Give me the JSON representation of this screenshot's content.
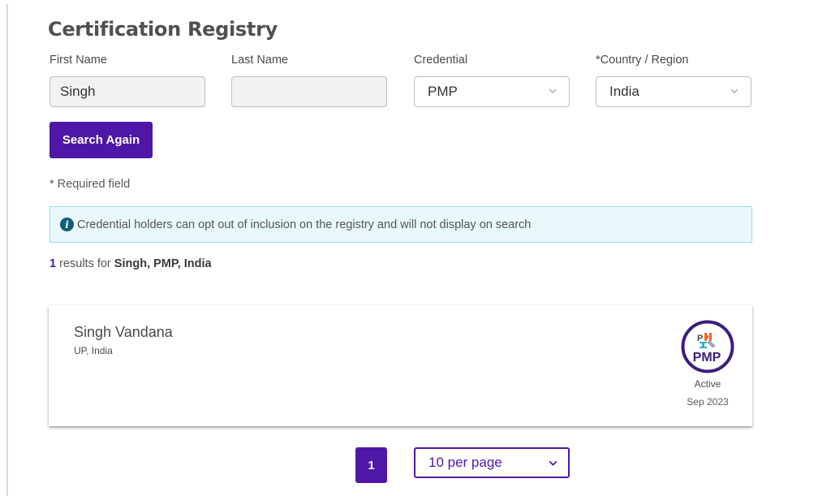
{
  "page": {
    "title": "Certification Registry"
  },
  "form": {
    "first_name": {
      "label": "First Name",
      "value": "Singh"
    },
    "last_name": {
      "label": "Last Name",
      "value": ""
    },
    "credential": {
      "label": "Credential",
      "value": "PMP"
    },
    "country": {
      "label": "*Country / Region",
      "value": "India"
    },
    "search_button": "Search Again",
    "required_note": "* Required field"
  },
  "info_banner": {
    "icon": "info-icon",
    "text": "Credential holders can opt out of inclusion on the registry and will not display on search"
  },
  "results": {
    "count": "1",
    "label": " results for ",
    "query": "Singh, PMP, India",
    "items": [
      {
        "name": "Singh Vandana",
        "location": "UP, India",
        "badge": "PMP",
        "status": "Active",
        "date": "Sep 2023"
      }
    ]
  },
  "pagination": {
    "current_page": "1",
    "per_page": "10 per page"
  },
  "colors": {
    "brand": "#4f17a8",
    "info_bg": "#e9f8fb",
    "info_border": "#9fdbe6",
    "info_icon": "#0f5f7a"
  }
}
